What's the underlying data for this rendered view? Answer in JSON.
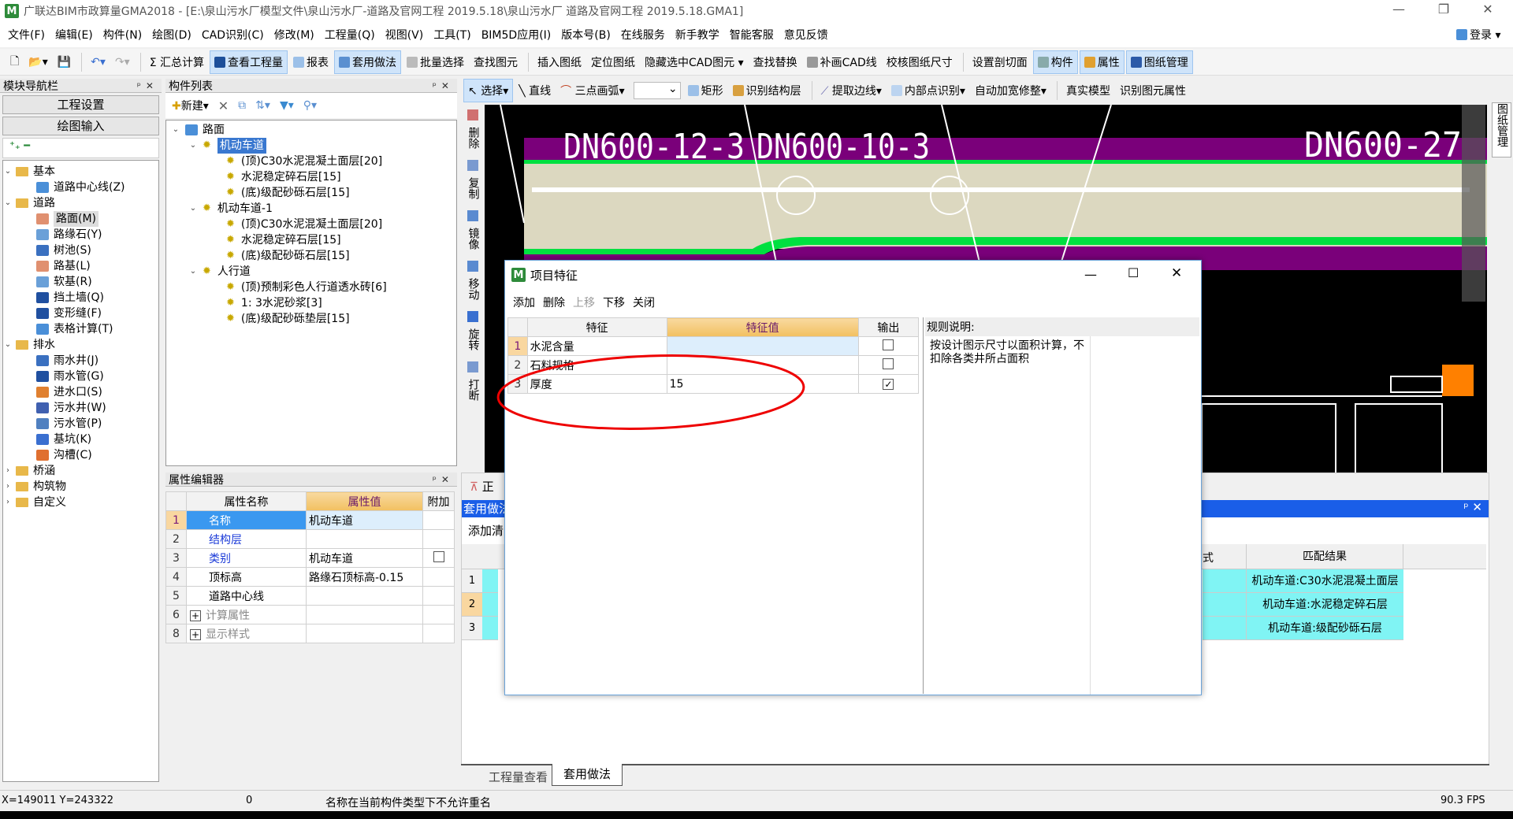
{
  "window": {
    "title": "广联达BIM市政算量GMA2018 - [E:\\泉山污水厂模型文件\\泉山污水厂-道路及官网工程  2019.5.18\\泉山污水厂  道路及官网工程  2019.5.18.GMA1]",
    "min": "—",
    "max": "❐",
    "close": "✕",
    "login": "登录"
  },
  "menu": [
    "文件(F)",
    "编辑(E)",
    "构件(N)",
    "绘图(D)",
    "CAD识别(C)",
    "修改(M)",
    "工程量(Q)",
    "视图(V)",
    "工具(T)",
    "BIM5D应用(I)",
    "版本号(B)",
    "在线服务",
    "新手教学",
    "智能客服",
    "意见反馈"
  ],
  "toolbar": {
    "sum": "汇总计算",
    "view_qty": "查看工程量",
    "report": "报表",
    "apply_method": "套用做法",
    "batch_select": "批量选择",
    "find_elem": "查找图元",
    "insert_drawing": "插入图纸",
    "locate_drawing": "定位图纸",
    "hide_cad": "隐藏选中CAD图元",
    "find_replace": "查找替换",
    "draw_cad": "补画CAD线",
    "check_size": "校核图纸尺寸",
    "section": "设置剖切面",
    "component": "构件",
    "property": "属性",
    "drawing_mgmt": "图纸管理"
  },
  "draw_toolbar": {
    "select": "选择",
    "line": "直线",
    "arc": "三点画弧",
    "rect": "矩形",
    "identify_layer": "识别结构层",
    "extract_edge": "提取边线",
    "inner_point": "内部点识别",
    "auto_widen": "自动加宽修整",
    "real_model": "真实模型",
    "identify_attr": "识别图元属性"
  },
  "nav": {
    "title": "模块导航栏",
    "project_settings": "工程设置",
    "drawing_input": "绘图输入",
    "tree": [
      {
        "label": "基本",
        "children": [
          "道路中心线(Z)"
        ]
      },
      {
        "label": "道路",
        "children": [
          "路面(M)",
          "路缘石(Y)",
          "树池(S)",
          "路基(L)",
          "软基(R)",
          "挡土墙(Q)",
          "变形缝(F)",
          "表格计算(T)"
        ]
      },
      {
        "label": "排水",
        "children": [
          "雨水井(J)",
          "雨水管(G)",
          "进水口(S)",
          "污水井(W)",
          "污水管(P)",
          "基坑(K)",
          "沟槽(C)"
        ]
      },
      {
        "label": "桥涵"
      },
      {
        "label": "构筑物"
      },
      {
        "label": "自定义"
      }
    ]
  },
  "component_list": {
    "title": "构件列表",
    "new": "新建",
    "root": "路面",
    "groups": [
      {
        "label": "机动车道",
        "items": [
          "(顶)C30水泥混凝土面层[20]",
          "水泥稳定碎石层[15]",
          "(底)级配砂砾石层[15]"
        ]
      },
      {
        "label": "机动车道-1",
        "items": [
          "(顶)C30水泥混凝土面层[20]",
          "水泥稳定碎石层[15]",
          "(底)级配砂砾石层[15]"
        ]
      },
      {
        "label": "人行道",
        "items": [
          "(顶)预制彩色人行道透水砖[6]",
          "1: 3水泥砂浆[3]",
          "(底)级配砂砾垫层[15]"
        ]
      }
    ]
  },
  "property_editor": {
    "title": "属性编辑器",
    "headers": [
      "属性名称",
      "属性值",
      "附加"
    ],
    "rows": [
      {
        "n": "1",
        "name": "名称",
        "value": "机动车道"
      },
      {
        "n": "2",
        "name": "结构层",
        "value": ""
      },
      {
        "n": "3",
        "name": "类别",
        "value": "机动车道"
      },
      {
        "n": "4",
        "name": "顶标高",
        "value": "路缘石顶标高-0.15"
      },
      {
        "n": "5",
        "name": "道路中心线",
        "value": ""
      },
      {
        "n": "6",
        "name": "计算属性",
        "value": ""
      },
      {
        "n": "8",
        "name": "显示样式",
        "value": ""
      }
    ]
  },
  "vertical_tools": [
    "删除",
    "复制",
    "镜像",
    "移动",
    "旋转",
    "打断"
  ],
  "cad": {
    "labels": [
      "DN600-12-3",
      "DN600-10-3",
      "DN600-27"
    ],
    "right_tab": "图纸管理"
  },
  "dialog": {
    "title": "项目特征",
    "buttons": [
      "添加",
      "删除",
      "上移",
      "下移",
      "关闭"
    ],
    "headers": [
      "特征",
      "特征值",
      "输出"
    ],
    "rows": [
      {
        "n": "1",
        "feature": "水泥含量",
        "value": "",
        "output": false
      },
      {
        "n": "2",
        "feature": "石料规格",
        "value": "",
        "output": false
      },
      {
        "n": "3",
        "feature": "厚度",
        "value": "15",
        "output": true
      }
    ],
    "rule_label": "规则说明:",
    "rule_text": "按设计图示尺寸以面积计算，不扣除各类井所占面积"
  },
  "bottom": {
    "mini_btn": "正",
    "header": "套用做法",
    "add_list": "添加清",
    "col_partial": "式",
    "match_header": "匹配结果",
    "rows": [
      {
        "n": "1",
        "match": "机动车道:C30水泥混凝土面层"
      },
      {
        "n": "2",
        "match": "机动车道:水泥稳定碎石层"
      },
      {
        "n": "3",
        "match": "机动车道:级配砂砾石层"
      }
    ],
    "tabs": [
      "工程量查看",
      "套用做法"
    ]
  },
  "status": {
    "coords": "X=149011 Y=243322",
    "count": "0",
    "message": "名称在当前构件类型下不允许重名",
    "fps": "90.3 FPS"
  }
}
